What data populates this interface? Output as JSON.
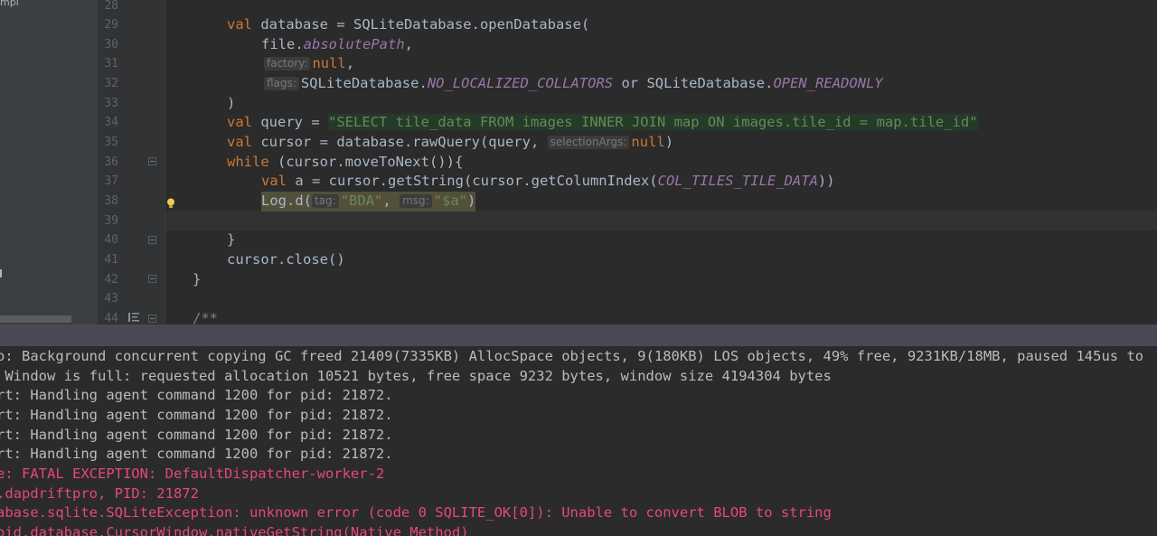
{
  "project_panel": {
    "label": "mpl"
  },
  "editor": {
    "lines": [
      {
        "num": "28"
      },
      {
        "num": "29"
      },
      {
        "num": "30"
      },
      {
        "num": "31"
      },
      {
        "num": "32"
      },
      {
        "num": "33"
      },
      {
        "num": "34"
      },
      {
        "num": "35"
      },
      {
        "num": "36"
      },
      {
        "num": "37"
      },
      {
        "num": "38"
      },
      {
        "num": "39"
      },
      {
        "num": "40"
      },
      {
        "num": "41"
      },
      {
        "num": "42"
      },
      {
        "num": "43"
      },
      {
        "num": "44"
      }
    ],
    "code": {
      "l29": {
        "kw": "val",
        "rest": " database = SQLiteDatabase.openDatabase("
      },
      "l30": {
        "obj": "file.",
        "prop": "absolutePath",
        "tail": ","
      },
      "l31": {
        "hint": "factory:",
        "kw": "null",
        "tail": ","
      },
      "l32": {
        "hint": "flags:",
        "a": "SQLiteDatabase.",
        "c1": "NO_LOCALIZED_COLLATORS",
        "mid": " or SQLiteDatabase.",
        "c2": "OPEN_READONLY"
      },
      "l33": {
        "text": ")"
      },
      "l34": {
        "kw": "val",
        "rest": " query = ",
        "str": "\"SELECT tile_data FROM images INNER JOIN map ON images.tile_id = map.tile_id\""
      },
      "l35": {
        "kw": "val",
        "rest": " cursor = database.rawQuery(query, ",
        "hint": "selectionArgs:",
        "kw2": "null",
        "tail": ")"
      },
      "l36": {
        "kw": "while",
        "rest": " (cursor.moveToNext()){"
      },
      "l37": {
        "kw": "val",
        "rest": " a = cursor.getString(cursor.getColumnIndex(",
        "const": "COL_TILES_TILE_DATA",
        "tail": "))"
      },
      "l38": {
        "a": "Log.d(",
        "hint1": "tag:",
        "s1": "\"BDA\"",
        "comma": ",",
        "hint2": "msg:",
        "s2": "\"$a\"",
        "tail": ")"
      },
      "l40": {
        "text": "}"
      },
      "l41": {
        "text": "cursor.close()"
      },
      "l42": {
        "text": "}"
      },
      "l44": {
        "text": "/**"
      }
    }
  },
  "console": {
    "lines": [
      {
        "text": "o: Background concurrent copying GC freed 21409(7335KB) AllocSpace objects, 9(180KB) LOS objects, 49% free, 9231KB/18MB, paused 145us to",
        "level": "normal"
      },
      {
        "text": " Window is full: requested allocation 10521 bytes, free space 9232 bytes, window size 4194304 bytes",
        "level": "normal"
      },
      {
        "text": "rt: Handling agent command 1200 for pid: 21872.",
        "level": "normal"
      },
      {
        "text": "rt: Handling agent command 1200 for pid: 21872.",
        "level": "normal"
      },
      {
        "text": "rt: Handling agent command 1200 for pid: 21872.",
        "level": "normal"
      },
      {
        "text": "rt: Handling agent command 1200 for pid: 21872.",
        "level": "normal"
      },
      {
        "text": "e: FATAL EXCEPTION: DefaultDispatcher-worker-2",
        "level": "error"
      },
      {
        "text": ".dapdriftpro, PID: 21872",
        "level": "error"
      },
      {
        "text": "abase.sqlite.SQLiteException: unknown error (code 0 SQLITE_OK[0]): Unable to convert BLOB to string",
        "level": "error"
      },
      {
        "text": "oid.database.CursorWindow.nativeGetString(Native Method)",
        "level": "error"
      }
    ]
  },
  "icons": {
    "fold": "fold-marker-icon",
    "bulb": "intention-bulb-icon",
    "doc": "documentation-icon"
  },
  "colors": {
    "keyword": "#cc7832",
    "string": "#6a8759",
    "constant": "#9876aa",
    "error": "#e5487b",
    "editor_bg": "#2b2b2b",
    "panel_separator": "#4b4856"
  }
}
